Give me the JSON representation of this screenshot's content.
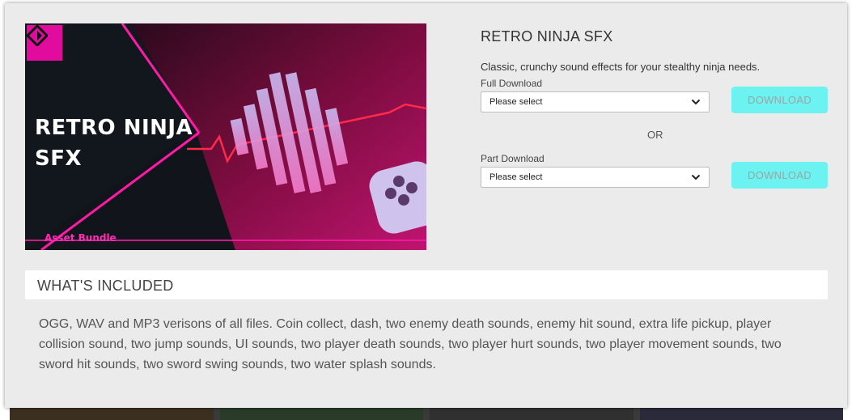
{
  "product": {
    "title": "RETRO NINJA SFX",
    "description": "Classic, crunchy sound effects for your stealthy ninja needs.",
    "hero_title": "RETRO NINJA SFX",
    "hero_tag": "Asset Bundle"
  },
  "downloads": {
    "full": {
      "label": "Full Download",
      "select_value": "Please select",
      "button_label": "DOWNLOAD"
    },
    "or_label": "OR",
    "part": {
      "label": "Part Download",
      "select_value": "Please select",
      "button_label": "DOWNLOAD"
    }
  },
  "included": {
    "heading": "WHAT'S INCLUDED",
    "text": "OGG, WAV and MP3 verisons of all files. Coin collect, dash, two enemy death sounds, enemy hit sound, extra life pickup, player collision sound, two jump sounds, UI sounds, two player death sounds, two player hurt sounds, two player movement sounds, two sword hit sounds, two sword swing sounds, two water splash sounds."
  },
  "colors": {
    "accent_magenta": "#e10b9e",
    "download_button": "#6cf2f0",
    "panel_bg": "#ebebeb"
  },
  "icons": [
    "gamemaker-logo-icon",
    "chevron-down-icon",
    "gamepad-icon"
  ]
}
